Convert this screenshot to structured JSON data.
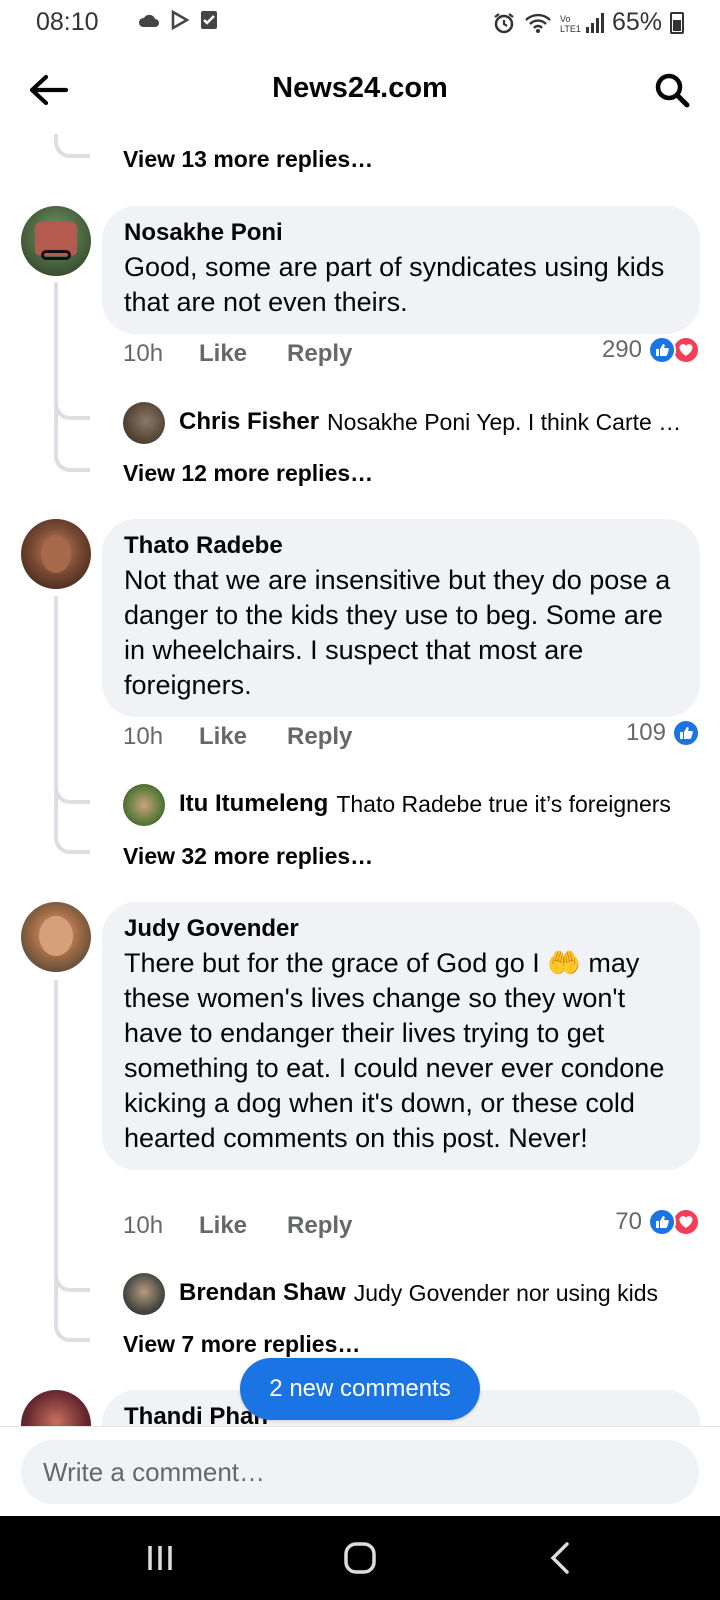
{
  "status_bar": {
    "time": "08:10",
    "battery": "65%"
  },
  "header": {
    "title": "News24.com"
  },
  "thread_top": {
    "view_more": "View 13 more replies…"
  },
  "comments": [
    {
      "name": "Nosakhe Poni",
      "text": "Good, some are part of syndicates using kids that are not even theirs.",
      "time": "10h",
      "like_label": "Like",
      "reply_label": "Reply",
      "reaction_count": "290",
      "reactions": [
        "like",
        "love"
      ],
      "reply_preview": {
        "name": "Chris Fisher",
        "text": "Nosakhe Poni Yep. I think Carte Bl…"
      },
      "view_more": "View 12 more replies…"
    },
    {
      "name": "Thato Radebe",
      "text": "Not that we are insensitive but they do pose a danger to the kids they use to beg. Some are in wheelchairs. I suspect that most are foreigners.",
      "time": "10h",
      "like_label": "Like",
      "reply_label": "Reply",
      "reaction_count": "109",
      "reactions": [
        "like"
      ],
      "reply_preview": {
        "name": "Itu Itumeleng",
        "text": "Thato Radebe true it’s foreigners"
      },
      "view_more": "View 32 more replies…"
    },
    {
      "name": "Judy Govender",
      "text": "There but for the grace of God go I 🤲 may these women's lives change so they won't have to endanger their lives trying to get something to eat. I could never ever condone kicking a dog when it's down, or these cold hearted comments on this post. Never!",
      "time": "10h",
      "like_label": "Like",
      "reply_label": "Reply",
      "reaction_count": "70",
      "reactions": [
        "like",
        "love"
      ],
      "reply_preview": {
        "name": "Brendan Shaw",
        "text": "Judy Govender nor using kids"
      },
      "view_more": "View 7 more replies…"
    },
    {
      "name": "Thandi Phan"
    }
  ],
  "new_comments_pill": "2 new comments",
  "composer": {
    "placeholder": "Write a comment…"
  },
  "colors": {
    "accent": "#1b74e4",
    "love": "#f33e58",
    "bubble": "#f0f2f5",
    "secondary_text": "#65676b"
  }
}
